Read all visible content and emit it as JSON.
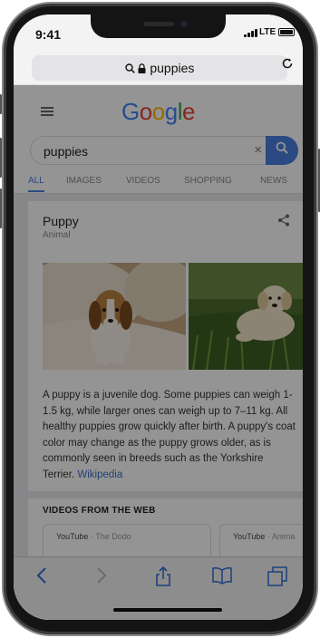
{
  "status": {
    "time": "9:41",
    "network": "LTE"
  },
  "browser": {
    "url_text": "puppies",
    "reload_icon": "reload-icon",
    "lock_icon": "lock-icon"
  },
  "google": {
    "logo": "Google",
    "search_query": "puppies",
    "clear_label": "×",
    "tabs": [
      "ALL",
      "IMAGES",
      "VIDEOS",
      "SHOPPING",
      "NEWS"
    ],
    "active_tab": "ALL"
  },
  "knowledge": {
    "title": "Puppy",
    "subtitle": "Animal",
    "description": "A puppy is a juvenile dog. Some puppies can weigh 1-1.5 kg, while larger ones can weigh up to 7–11 kg. All healthy puppies grow quickly after birth. A puppy's coat color may change as the puppy grows older, as is commonly seen in breeds such as the Yorkshire Terrier.",
    "source_link": "Wikipedia"
  },
  "videos": {
    "heading": "VIDEOS FROM THE WEB",
    "cards": [
      {
        "site": "YouTube",
        "channel": "The Dodo"
      },
      {
        "site": "YouTube",
        "channel": "Anima"
      }
    ]
  },
  "toolbar": {
    "back_icon": "back-icon",
    "forward_icon": "forward-icon",
    "share_icon": "share-icon",
    "bookmarks_icon": "bookmarks-icon",
    "tabs_icon": "tabs-icon"
  },
  "colors": {
    "google_blue": "#4285F4",
    "google_red": "#EA4335",
    "google_yellow": "#FBBC05",
    "google_green": "#34A853",
    "link": "#3a6fc4"
  }
}
